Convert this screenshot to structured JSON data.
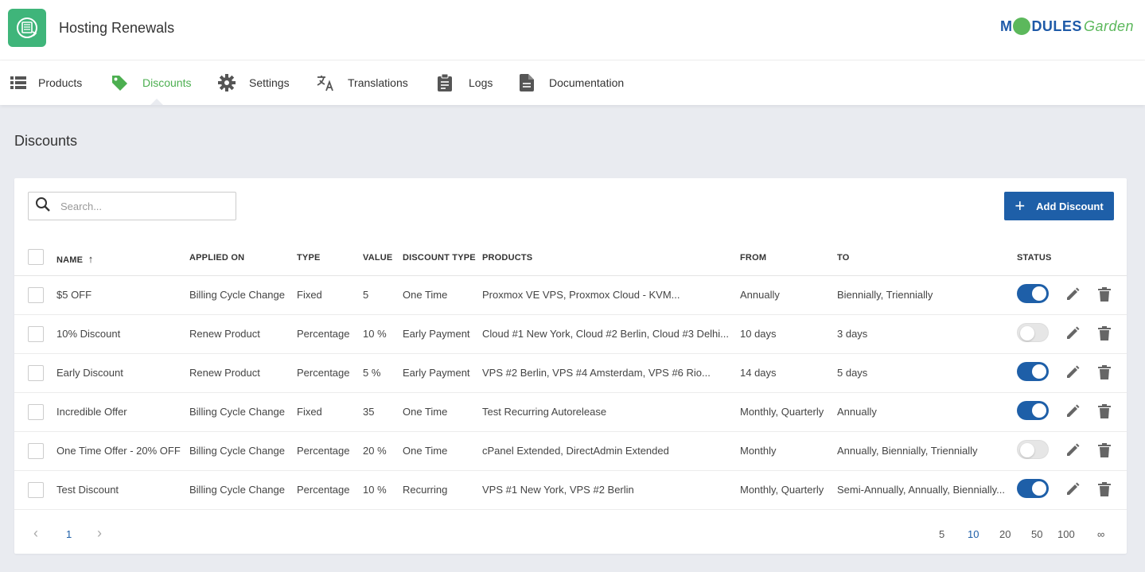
{
  "app": {
    "title": "Hosting Renewals",
    "brand_a": "M",
    "brand_b": "DULES",
    "brand_c": "Garden"
  },
  "nav": [
    {
      "label": "Products",
      "icon": "list-icon"
    },
    {
      "label": "Discounts",
      "icon": "tag-icon",
      "active": true
    },
    {
      "label": "Settings",
      "icon": "gear-icon"
    },
    {
      "label": "Translations",
      "icon": "translate-icon"
    },
    {
      "label": "Logs",
      "icon": "clipboard-icon"
    },
    {
      "label": "Documentation",
      "icon": "document-icon"
    }
  ],
  "page": {
    "title": "Discounts"
  },
  "toolbar": {
    "search_placeholder": "Search...",
    "add_label": "Add Discount"
  },
  "table": {
    "headers": [
      "NAME",
      "APPLIED ON",
      "TYPE",
      "VALUE",
      "DISCOUNT TYPE",
      "PRODUCTS",
      "FROM",
      "TO",
      "STATUS"
    ],
    "sort_indicator": "↑",
    "rows": [
      {
        "name": "$5 OFF",
        "applied_on": "Billing Cycle Change",
        "type": "Fixed",
        "value": "5",
        "discount_type": "One Time",
        "products": "Proxmox VE VPS, Proxmox Cloud - KVM...",
        "from": "Annually",
        "to": "Biennially, Triennially",
        "status": true
      },
      {
        "name": "10% Discount",
        "applied_on": "Renew Product",
        "type": "Percentage",
        "value": "10 %",
        "discount_type": "Early Payment",
        "products": "Cloud #1 New York, Cloud #2 Berlin, Cloud #3 Delhi...",
        "from": "10 days",
        "to": "3 days",
        "status": false
      },
      {
        "name": "Early Discount",
        "applied_on": "Renew Product",
        "type": "Percentage",
        "value": "5 %",
        "discount_type": "Early Payment",
        "products": "VPS #2 Berlin, VPS #4 Amsterdam, VPS #6 Rio...",
        "from": "14 days",
        "to": "5 days",
        "status": true
      },
      {
        "name": "Incredible Offer",
        "applied_on": "Billing Cycle Change",
        "type": "Fixed",
        "value": "35",
        "discount_type": "One Time",
        "products": "Test Recurring Autorelease",
        "from": "Monthly, Quarterly",
        "to": "Annually",
        "status": true
      },
      {
        "name": "One Time Offer - 20% OFF",
        "applied_on": "Billing Cycle Change",
        "type": "Percentage",
        "value": "20 %",
        "discount_type": "One Time",
        "products": "cPanel Extended, DirectAdmin Extended",
        "from": "Monthly",
        "to": "Annually, Biennially, Triennially",
        "status": false
      },
      {
        "name": "Test Discount",
        "applied_on": "Billing Cycle Change",
        "type": "Percentage",
        "value": "10 %",
        "discount_type": "Recurring",
        "products": "VPS #1 New York, VPS #2 Berlin",
        "from": "Monthly, Quarterly",
        "to": "Semi-Annually, Annually, Biennially...",
        "status": true
      }
    ]
  },
  "pagination": {
    "prev": "‹",
    "next": "›",
    "current_page": "1",
    "page_sizes": [
      "5",
      "10",
      "20",
      "50",
      "100",
      "∞"
    ],
    "active_size": "10"
  },
  "colors": {
    "accent": "#1e5fa8",
    "active_nav": "#4caf50",
    "logo_bg": "#3fb57a"
  }
}
